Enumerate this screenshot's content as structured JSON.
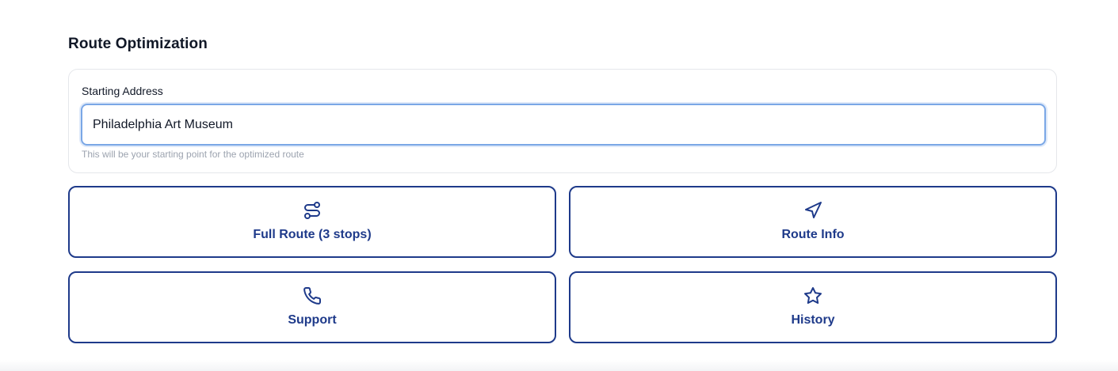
{
  "section": {
    "title": "Route Optimization"
  },
  "starting_address": {
    "label": "Starting Address",
    "value": "Philadelphia Art Museum",
    "help_text": "This will be your starting point for the optimized route"
  },
  "actions": [
    {
      "label": "Full Route (3 stops)",
      "icon": "route-icon"
    },
    {
      "label": "Route Info",
      "icon": "navigation-icon"
    },
    {
      "label": "Support",
      "icon": "phone-icon"
    },
    {
      "label": "History",
      "icon": "star-icon"
    }
  ],
  "colors": {
    "accent": "#1e3a8a",
    "input_focus": "#7aa7e6",
    "help_text": "#9ca3af",
    "card_border": "#e5e7eb"
  }
}
